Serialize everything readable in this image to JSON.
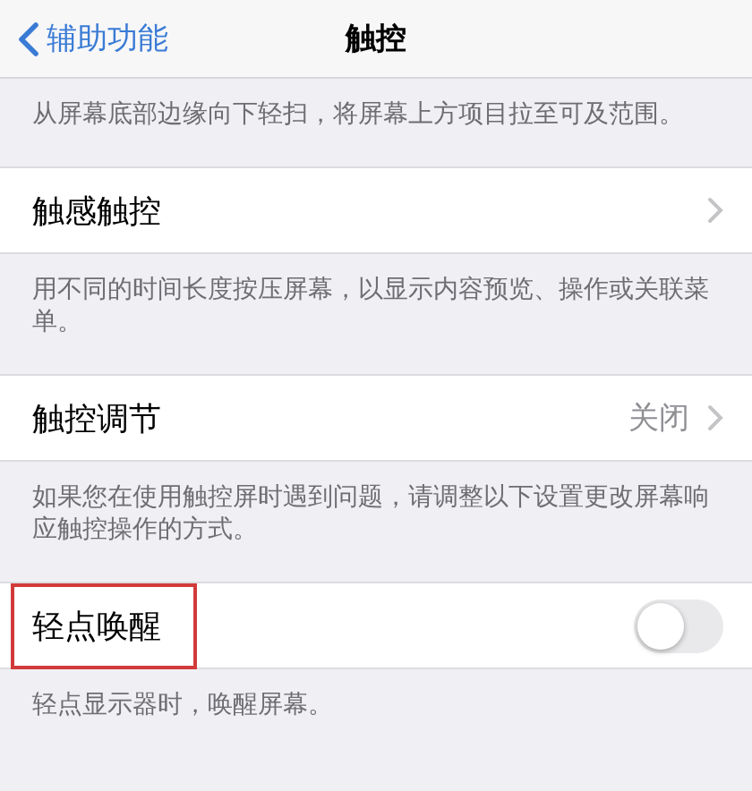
{
  "nav": {
    "back": "辅助功能",
    "title": "触控"
  },
  "sections": [
    {
      "kind": "footer",
      "text": "从屏幕底部边缘向下轻扫，将屏幕上方项目拉至可及范围。"
    },
    {
      "kind": "link",
      "label": "触感触控"
    },
    {
      "kind": "footer",
      "text": "用不同的时间长度按压屏幕，以显示内容预览、操作或关联菜单。"
    },
    {
      "kind": "link",
      "label": "触控调节",
      "value": "关闭"
    },
    {
      "kind": "footer",
      "text": "如果您在使用触控屏时遇到问题，请调整以下设置更改屏幕响应触控操作的方式。"
    },
    {
      "kind": "toggle",
      "label": "轻点唤醒",
      "on": false,
      "highlighted": true
    },
    {
      "kind": "footer",
      "text": "轻点显示器时，唤醒屏幕。"
    }
  ]
}
